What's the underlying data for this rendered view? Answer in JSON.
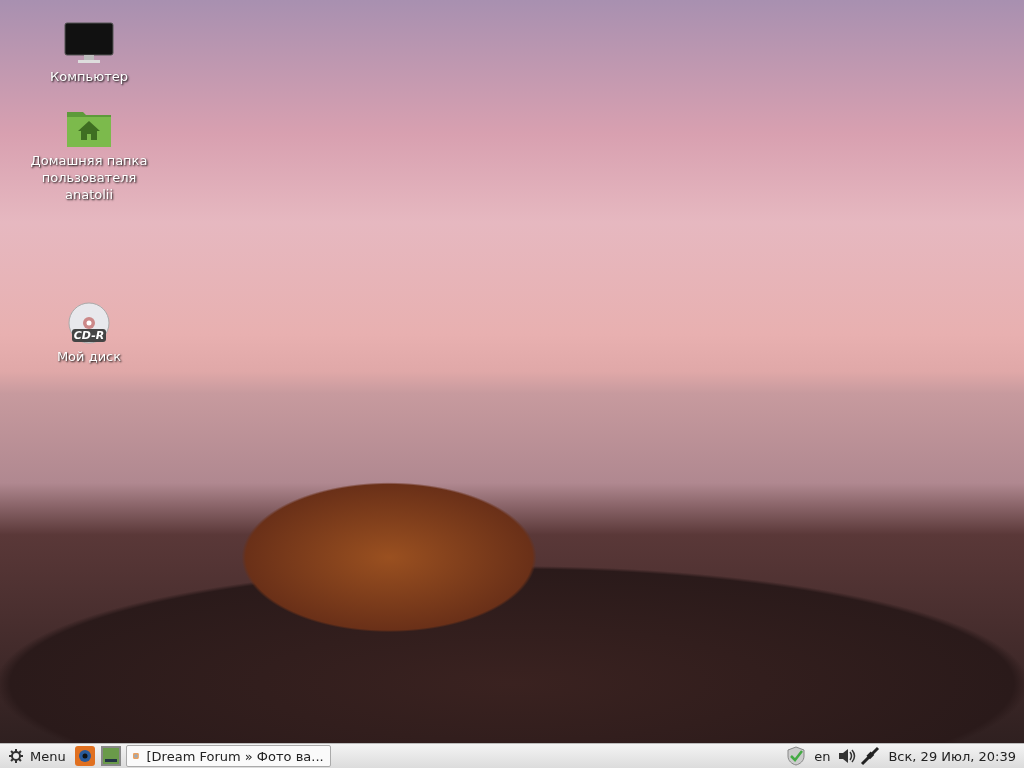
{
  "desktop": {
    "icons": [
      {
        "kind": "computer",
        "label": "Компьютер"
      },
      {
        "kind": "home",
        "label": "Домашняя папка пользователя anatolii"
      },
      {
        "kind": "disc",
        "label": "Мой диск",
        "badge": "CD-R"
      }
    ]
  },
  "taskbar": {
    "menu": "Menu",
    "window_button": "[Dream Forum » Фото ва...",
    "keyboard_layout": "en",
    "clock": "Вск, 29 Июл, 20:39"
  }
}
